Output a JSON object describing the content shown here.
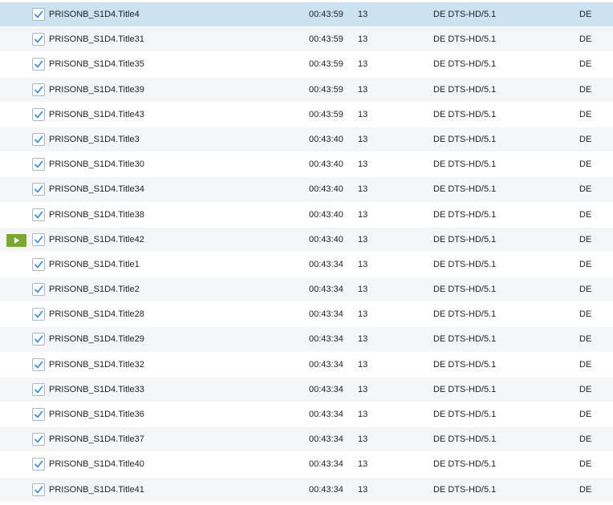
{
  "colors": {
    "accent": "#3f8fd2",
    "play_button": "#7aa833",
    "selected_row": "#cce2f1",
    "alt_row": "#f4f5f7"
  },
  "icons": {
    "checkbox": "checkmark-icon",
    "play": "play-icon"
  },
  "titles": [
    {
      "name": "PRISONB_S1D4.Title4",
      "duration": "00:43:59",
      "chapters": "13",
      "audio": "DE DTS-HD/5.1",
      "lang": "DE",
      "checked": true,
      "selected": true,
      "playing": false
    },
    {
      "name": "PRISONB_S1D4.Title31",
      "duration": "00:43:59",
      "chapters": "13",
      "audio": "DE DTS-HD/5.1",
      "lang": "DE",
      "checked": true,
      "selected": false,
      "playing": false
    },
    {
      "name": "PRISONB_S1D4.Title35",
      "duration": "00:43:59",
      "chapters": "13",
      "audio": "DE DTS-HD/5.1",
      "lang": "DE",
      "checked": true,
      "selected": false,
      "playing": false
    },
    {
      "name": "PRISONB_S1D4.Title39",
      "duration": "00:43:59",
      "chapters": "13",
      "audio": "DE DTS-HD/5.1",
      "lang": "DE",
      "checked": true,
      "selected": false,
      "playing": false
    },
    {
      "name": "PRISONB_S1D4.Title43",
      "duration": "00:43:59",
      "chapters": "13",
      "audio": "DE DTS-HD/5.1",
      "lang": "DE",
      "checked": true,
      "selected": false,
      "playing": false
    },
    {
      "name": "PRISONB_S1D4.Title3",
      "duration": "00:43:40",
      "chapters": "13",
      "audio": "DE DTS-HD/5.1",
      "lang": "DE",
      "checked": true,
      "selected": false,
      "playing": false
    },
    {
      "name": "PRISONB_S1D4.Title30",
      "duration": "00:43:40",
      "chapters": "13",
      "audio": "DE DTS-HD/5.1",
      "lang": "DE",
      "checked": true,
      "selected": false,
      "playing": false
    },
    {
      "name": "PRISONB_S1D4.Title34",
      "duration": "00:43:40",
      "chapters": "13",
      "audio": "DE DTS-HD/5.1",
      "lang": "DE",
      "checked": true,
      "selected": false,
      "playing": false
    },
    {
      "name": "PRISONB_S1D4.Title38",
      "duration": "00:43:40",
      "chapters": "13",
      "audio": "DE DTS-HD/5.1",
      "lang": "DE",
      "checked": true,
      "selected": false,
      "playing": false
    },
    {
      "name": "PRISONB_S1D4.Title42",
      "duration": "00:43:40",
      "chapters": "13",
      "audio": "DE DTS-HD/5.1",
      "lang": "DE",
      "checked": true,
      "selected": false,
      "playing": true
    },
    {
      "name": "PRISONB_S1D4.Title1",
      "duration": "00:43:34",
      "chapters": "13",
      "audio": "DE DTS-HD/5.1",
      "lang": "DE",
      "checked": true,
      "selected": false,
      "playing": false
    },
    {
      "name": "PRISONB_S1D4.Title2",
      "duration": "00:43:34",
      "chapters": "13",
      "audio": "DE DTS-HD/5.1",
      "lang": "DE",
      "checked": true,
      "selected": false,
      "playing": false
    },
    {
      "name": "PRISONB_S1D4.Title28",
      "duration": "00:43:34",
      "chapters": "13",
      "audio": "DE DTS-HD/5.1",
      "lang": "DE",
      "checked": true,
      "selected": false,
      "playing": false
    },
    {
      "name": "PRISONB_S1D4.Title29",
      "duration": "00:43:34",
      "chapters": "13",
      "audio": "DE DTS-HD/5.1",
      "lang": "DE",
      "checked": true,
      "selected": false,
      "playing": false
    },
    {
      "name": "PRISONB_S1D4.Title32",
      "duration": "00:43:34",
      "chapters": "13",
      "audio": "DE DTS-HD/5.1",
      "lang": "DE",
      "checked": true,
      "selected": false,
      "playing": false
    },
    {
      "name": "PRISONB_S1D4.Title33",
      "duration": "00:43:34",
      "chapters": "13",
      "audio": "DE DTS-HD/5.1",
      "lang": "DE",
      "checked": true,
      "selected": false,
      "playing": false
    },
    {
      "name": "PRISONB_S1D4.Title36",
      "duration": "00:43:34",
      "chapters": "13",
      "audio": "DE DTS-HD/5.1",
      "lang": "DE",
      "checked": true,
      "selected": false,
      "playing": false
    },
    {
      "name": "PRISONB_S1D4.Title37",
      "duration": "00:43:34",
      "chapters": "13",
      "audio": "DE DTS-HD/5.1",
      "lang": "DE",
      "checked": true,
      "selected": false,
      "playing": false
    },
    {
      "name": "PRISONB_S1D4.Title40",
      "duration": "00:43:34",
      "chapters": "13",
      "audio": "DE DTS-HD/5.1",
      "lang": "DE",
      "checked": true,
      "selected": false,
      "playing": false
    },
    {
      "name": "PRISONB_S1D4.Title41",
      "duration": "00:43:34",
      "chapters": "13",
      "audio": "DE DTS-HD/5.1",
      "lang": "DE",
      "checked": true,
      "selected": false,
      "playing": false
    }
  ]
}
